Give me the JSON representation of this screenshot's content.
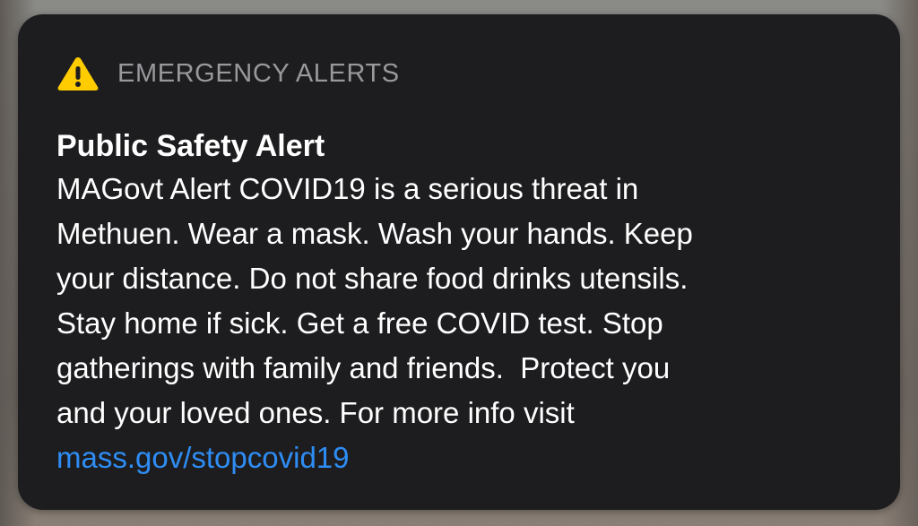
{
  "alert": {
    "category": "EMERGENCY ALERTS",
    "title": "Public Safety Alert",
    "body": "MAGovt Alert COVID19 is a serious threat in\nMethuen. Wear a mask. Wash your hands. Keep\nyour distance. Do not share food drinks utensils.\nStay home if sick. Get a free COVID test. Stop\ngatherings with family and friends.  Protect you\nand your loved ones. For more info visit",
    "link": "mass.gov/stopcovid19",
    "icon": "warning-triangle-icon",
    "colors": {
      "card_background": "#1d1d1f",
      "icon_fill": "#ffcc00",
      "header_text": "#98989d",
      "body_text": "#ffffff",
      "link_text": "#2e8df5"
    }
  }
}
